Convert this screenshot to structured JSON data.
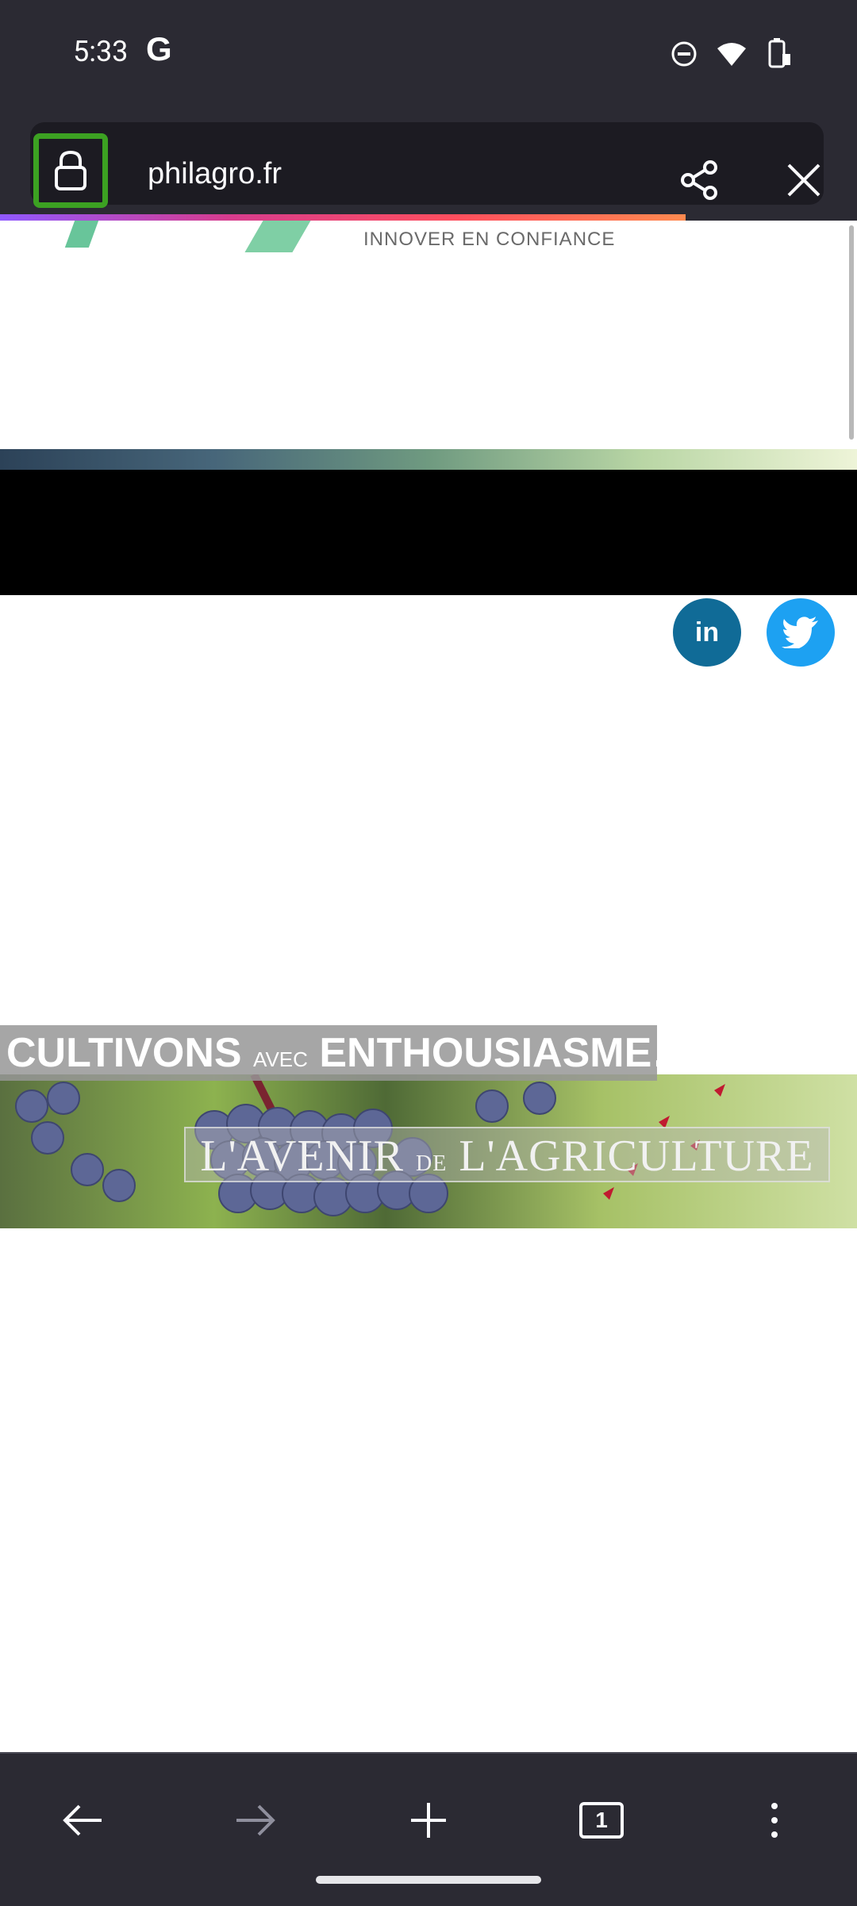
{
  "status_bar": {
    "time": "5:33",
    "g_label": "G",
    "icons": [
      "dnd-icon",
      "wifi-icon",
      "battery-icon"
    ]
  },
  "toolbar": {
    "url": "philagro.fr",
    "lock_icon": "lock-icon",
    "share_icon": "share-icon",
    "close_icon": "close-icon",
    "progress": 0.8
  },
  "page": {
    "tagline": "INNOVER EN CONFIANCE",
    "social": {
      "linkedin_label": "in",
      "twitter_icon": "twitter-icon"
    },
    "banner": {
      "headline_main": "CULTIVONS",
      "headline_small": "AVEC",
      "headline_end": "ENTHOUSIASME…",
      "sub_part1": "L'AVENIR",
      "sub_de": "DE",
      "sub_part2": "L'AGRICULTURE"
    }
  },
  "bottom_nav": {
    "tab_count": "1",
    "back_icon": "back-arrow-icon",
    "forward_icon": "forward-arrow-icon",
    "new_tab_icon": "plus-icon",
    "menu_icon": "more-vertical-icon"
  },
  "colors": {
    "chrome": "#2b2a33",
    "url_field": "#1c1b22",
    "highlight": "#3ca122",
    "linkedin": "#106b97",
    "twitter": "#1da1f2"
  }
}
